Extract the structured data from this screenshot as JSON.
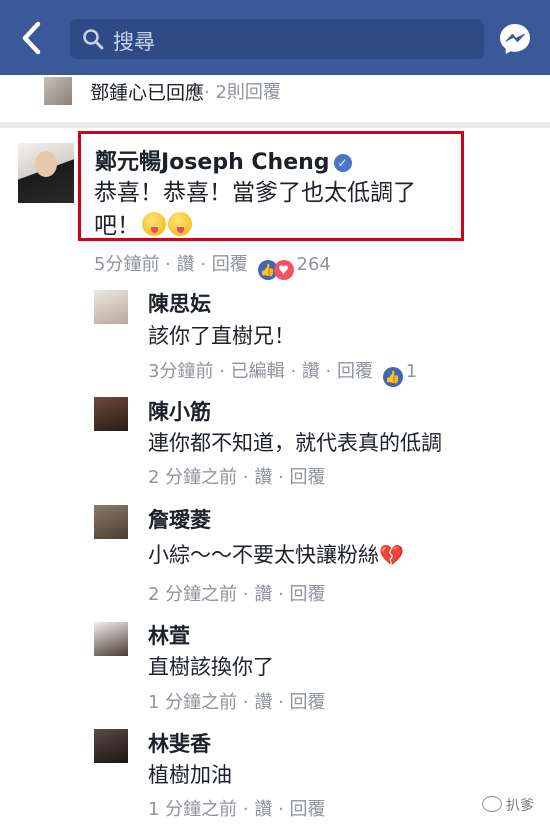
{
  "topbar": {
    "search_placeholder": "搜尋",
    "colors": {
      "bar": "#3b5998"
    }
  },
  "replied": {
    "name": "鄧鍾心已回應",
    "meta": " · 2則回覆"
  },
  "main_comment": {
    "author": "鄭元暢Joseph Cheng",
    "text": "恭喜！恭喜！當爹了也太低調了吧！",
    "time": "5分鐘前",
    "like_label": "讚",
    "reply_label": "回覆",
    "reaction_count": "264"
  },
  "replies": [
    {
      "name": "陳思妘",
      "text": "該你了直樹兄！",
      "time": "3分鐘前",
      "edited": "已編輯",
      "like_label": "讚",
      "reply_label": "回覆",
      "reaction_count": "1"
    },
    {
      "name": "陳小筋",
      "text": "連你都不知道，就代表真的低調",
      "time": "2 分鐘之前",
      "like_label": "讚",
      "reply_label": "回覆"
    },
    {
      "name": "詹璦菱",
      "text": "小綜～～不要太快讓粉絲",
      "time": "2 分鐘之前",
      "like_label": "讚",
      "reply_label": "回覆"
    },
    {
      "name": "林萓",
      "text": "直樹該換你了",
      "time": "1 分鐘之前",
      "like_label": "讚",
      "reply_label": "回覆"
    },
    {
      "name": "林斐香",
      "text": "植樹加油",
      "time": "1 分鐘之前",
      "like_label": "讚",
      "reply_label": "回覆"
    }
  ],
  "watermark": {
    "text": "扒爹"
  },
  "sep": " · "
}
